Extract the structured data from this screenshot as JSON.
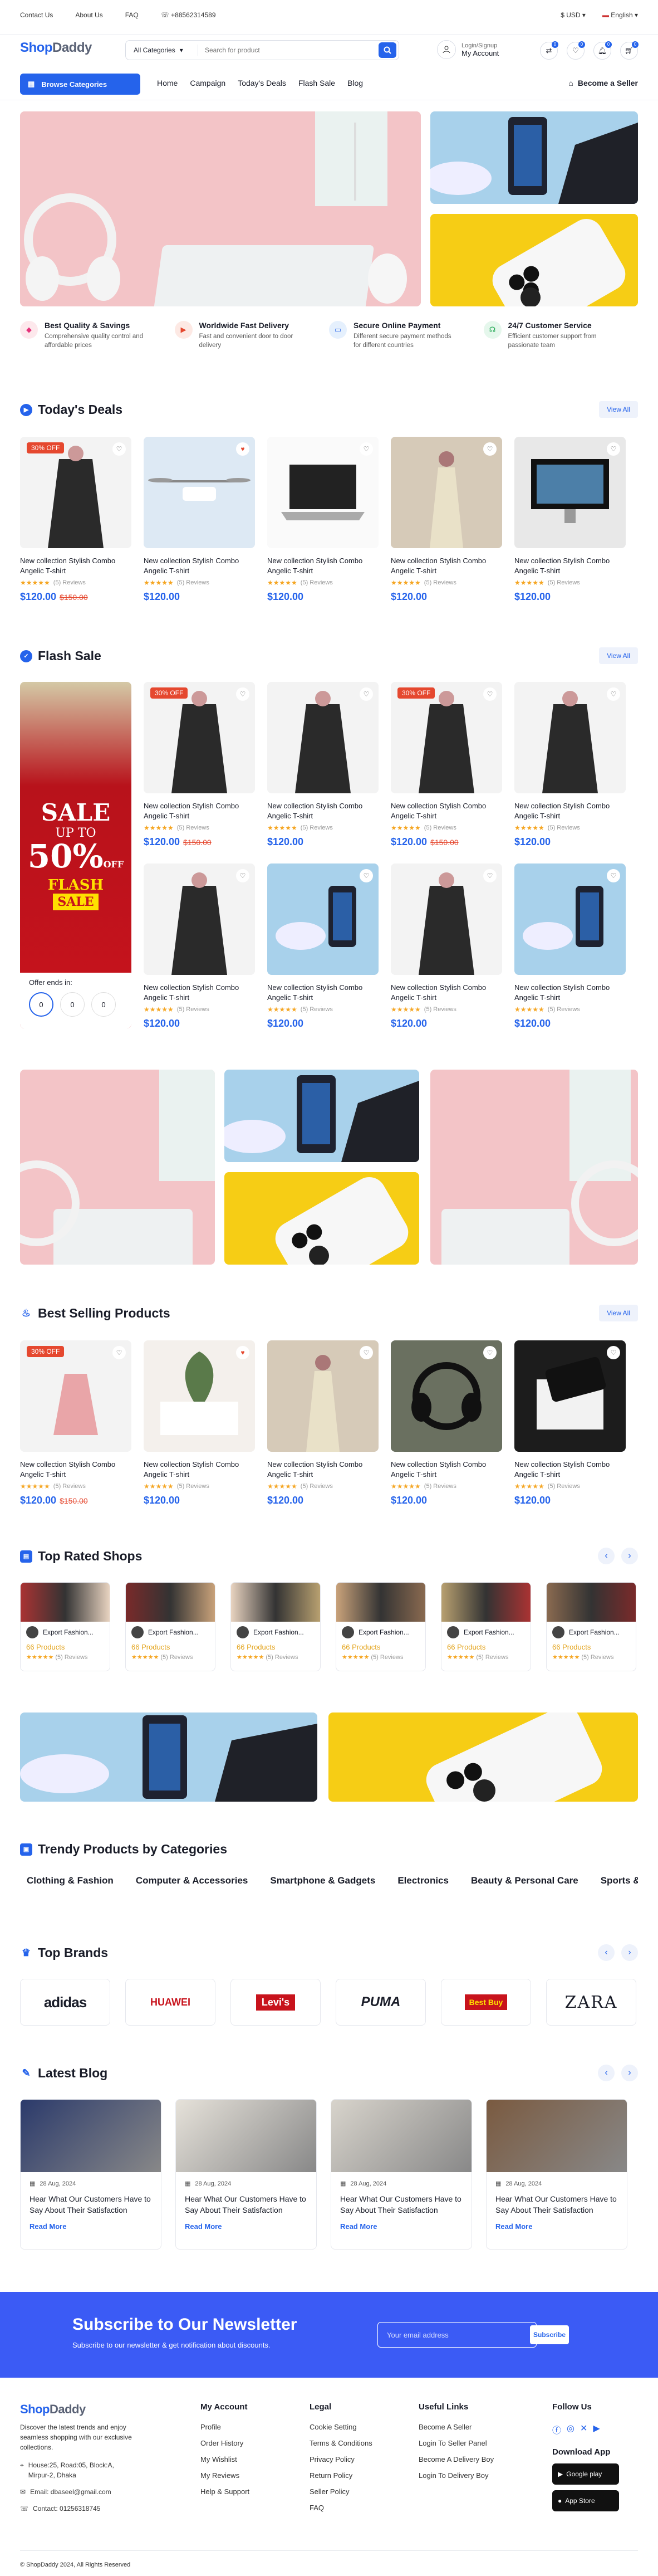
{
  "topbar": {
    "links": [
      "Contact Us",
      "About Us",
      "FAQ"
    ],
    "phone": "+88562314589",
    "currency": "USD",
    "language": "English"
  },
  "header": {
    "logo_a": "Shop",
    "logo_b": "Daddy",
    "search_category": "All Categories",
    "search_placeholder": "Search for product",
    "login": "Login/Signup",
    "account": "My Account",
    "badges": [
      "0",
      "0",
      "0",
      "0"
    ]
  },
  "nav": {
    "browse": "Browse Categories",
    "links": [
      "Home",
      "Campaign",
      "Today's Deals",
      "Flash Sale",
      "Blog"
    ],
    "seller": "Become a Seller"
  },
  "features": [
    {
      "title": "Best Quality & Savings",
      "desc": "Comprehensive quality control and affordable prices"
    },
    {
      "title": "Worldwide Fast Delivery",
      "desc": "Fast and convenient door to door delivery"
    },
    {
      "title": "Secure Online Payment",
      "desc": "Different secure payment methods for different countries"
    },
    {
      "title": "24/7 Customer Service",
      "desc": "Efficient customer support from passionate team"
    }
  ],
  "sections": {
    "deals": "Today's Deals",
    "flash": "Flash Sale",
    "best": "Best Selling Products",
    "shops": "Top Rated Shops",
    "trendy": "Trendy Products by Categories",
    "brands": "Top Brands",
    "blog": "Latest Blog",
    "view_all": "View All"
  },
  "product": {
    "name": "New collection Stylish Combo Angelic T-shirt",
    "reviews": "(5) Reviews",
    "price": "$120.00",
    "old_price": "$150.00",
    "discount": "30% OFF",
    "stars": "★★★★★"
  },
  "flash_promo": {
    "line1": "SALE",
    "line2": "UP TO",
    "line3": "50%",
    "line4": "OFF",
    "line5": "FLASH",
    "line6": "SALE",
    "offer": "Offer ends in:",
    "timer": [
      "0",
      "0",
      "0"
    ]
  },
  "shop": {
    "name": "Export Fashion...",
    "products": "66 Products",
    "reviews": "(5) Reviews"
  },
  "categories": [
    "Clothing & Fashion",
    "Computer & Accessories",
    "Smartphone & Gadgets",
    "Electronics",
    "Beauty & Personal Care",
    "Sports & Fitness"
  ],
  "brands": [
    "adidas",
    "HUAWEI",
    "Levi's",
    "PUMA",
    "Best Buy",
    "ZARA"
  ],
  "blog": {
    "date": "28 Aug, 2024",
    "title": "Hear What Our Customers Have to Say About Their Satisfaction",
    "read": "Read More"
  },
  "newsletter": {
    "title": "Subscribe to Our Newsletter",
    "desc": "Subscribe to our newsletter & get notification about discounts.",
    "placeholder": "Your email address",
    "button": "Subscribe"
  },
  "footer": {
    "desc": "Discover the latest trends and enjoy seamless shopping with our exclusive collections.",
    "address": "House:25, Road:05, Block:A, Mirpur-2, Dhaka",
    "email": "Email: dbaseel@gmail.com",
    "contact": "Contact: 01256318745",
    "cols": [
      {
        "title": "My Account",
        "items": [
          "Profile",
          "Order History",
          "My Wishlist",
          "My Reviews",
          "Help & Support"
        ]
      },
      {
        "title": "Legal",
        "items": [
          "Cookie Setting",
          "Terms & Conditions",
          "Privacy Policy",
          "Return Policy",
          "Seller Policy",
          "FAQ"
        ]
      },
      {
        "title": "Useful Links",
        "items": [
          "Become A Seller",
          "Login To Seller Panel",
          "Become A Delivery Boy",
          "Login To Delivery Boy"
        ]
      }
    ],
    "follow": "Follow Us",
    "download": "Download App",
    "gplay": "Google play",
    "appstore": "App Store",
    "copyright": "© ShopDaddy 2024, All Rights Reserved"
  },
  "colors": {
    "accent": "#2563eb",
    "sale": "#e5482f"
  }
}
